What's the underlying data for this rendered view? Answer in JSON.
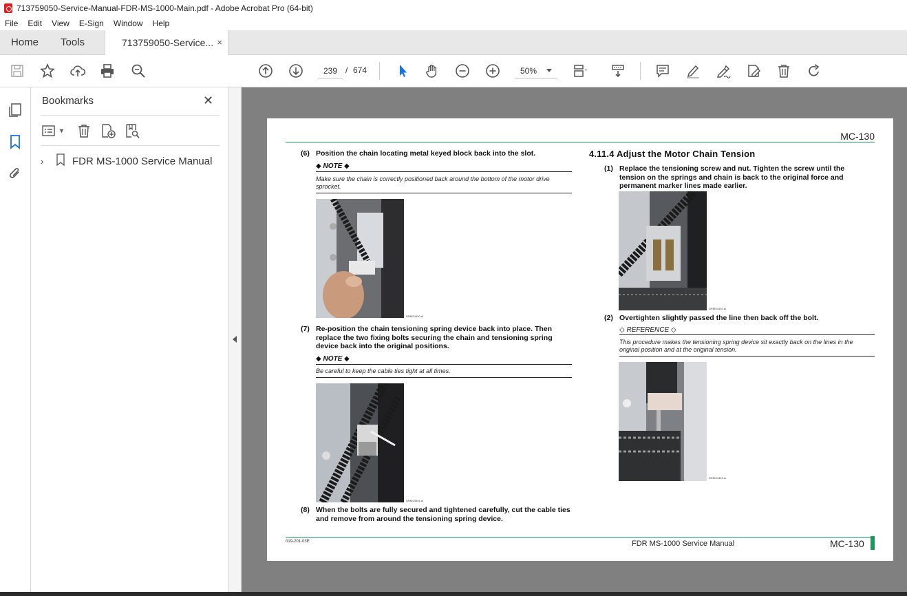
{
  "window": {
    "title": "713759050-Service-Manual-FDR-MS-1000-Main.pdf - Adobe Acrobat Pro (64-bit)"
  },
  "menu": [
    "File",
    "Edit",
    "View",
    "E-Sign",
    "Window",
    "Help"
  ],
  "tabs": {
    "home": "Home",
    "tools": "Tools",
    "document": "713759050-Service...",
    "close": "×"
  },
  "toolbar": {
    "current_page": "239",
    "page_sep": "/",
    "total_pages": "674",
    "zoom": "50%"
  },
  "bookmarks": {
    "title": "Bookmarks",
    "close": "✕",
    "items": [
      {
        "label": "FDR MS-1000 Service Manual",
        "expanded": false
      }
    ]
  },
  "page": {
    "header": "MC-130",
    "left": {
      "step6": {
        "num": "(6)",
        "text": "Position the chain locating metal keyed block back into the slot."
      },
      "note1": {
        "head": "◆ NOTE ◆",
        "body": "Make sure the chain is correctly positioned back around the bottom of the motor drive sprocket."
      },
      "fig1": "DRMS4490.ai",
      "step7": {
        "num": "(7)",
        "text": "Re-position the chain tensioning spring device back into place. Then replace the two fixing bolts securing the chain and tensioning spring device back into the original positions."
      },
      "note2": {
        "head": "◆ NOTE ◆",
        "body": "Be careful to keep the cable ties tight at all times."
      },
      "fig2": "DRMS4491.ai",
      "step8": {
        "num": "(8)",
        "text": "When the bolts are fully secured and tightened carefully, cut the cable ties and remove from around the tensioning spring device."
      }
    },
    "right": {
      "section": "4.11.4   Adjust the Motor Chain Tension",
      "step1": {
        "num": "(1)",
        "text": "Replace the tensioning screw and nut. Tighten the screw until the tension on the springs and chain is back to the original force and permanent marker lines made earlier."
      },
      "fig3": "DRMS4492.ai",
      "step2": {
        "num": "(2)",
        "text": "Overtighten slightly passed the line then back off the bolt."
      },
      "ref": {
        "head": "◇ REFERENCE ◇",
        "body": "This procedure makes the tensioning spring device sit exactly back on the lines in the original position and at the original tension."
      },
      "fig4": "DRMS4493.ai"
    },
    "footer": {
      "code": "019-201-03E",
      "manual": "FDR MS-1000 Service Manual",
      "page": "MC-130"
    }
  },
  "colors": {
    "accent_green": "#1a9a5a",
    "acrobat_red": "#e02020",
    "selected_tool_blue": "#1473e6",
    "canvas_gray": "#808080"
  }
}
